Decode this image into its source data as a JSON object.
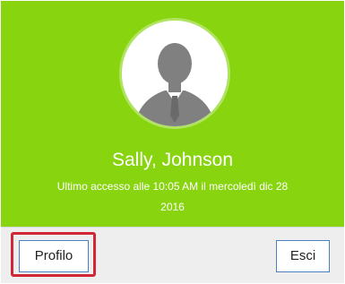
{
  "user": {
    "name": "Sally, Johnson",
    "last_access_line1": "Ultimo accesso alle 10:05 AM il mercoledì dic 28",
    "last_access_line2": "2016"
  },
  "actions": {
    "profile_label": "Profilo",
    "logout_label": "Esci"
  },
  "colors": {
    "header_bg": "#88d40f",
    "avatar_figure": "#808080",
    "focus_ring": "#d02635",
    "button_border": "#4a7fc1"
  },
  "icons": {
    "avatar": "user-silhouette-icon"
  }
}
